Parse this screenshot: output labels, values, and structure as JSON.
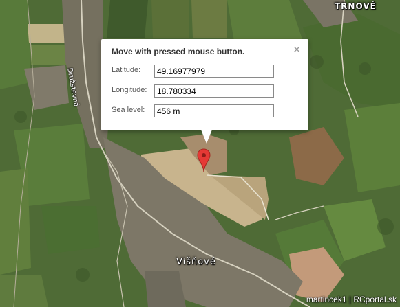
{
  "map": {
    "places": {
      "trnove": "TRNOVÉ",
      "visnove": "Višňové",
      "street": "Družstevná"
    }
  },
  "popup": {
    "title": "Move with pressed mouse button.",
    "close_icon": "close-icon",
    "latitude_label": "Latitude:",
    "latitude_value": "49.16977979",
    "longitude_label": "Longitude:",
    "longitude_value": "18.780334",
    "sea_level_label": "Sea level:",
    "sea_level_value": "456 m"
  },
  "marker": {
    "icon": "map-pin-icon",
    "color": "#e53935"
  },
  "attribution": "martincek1 | RCportal.sk"
}
